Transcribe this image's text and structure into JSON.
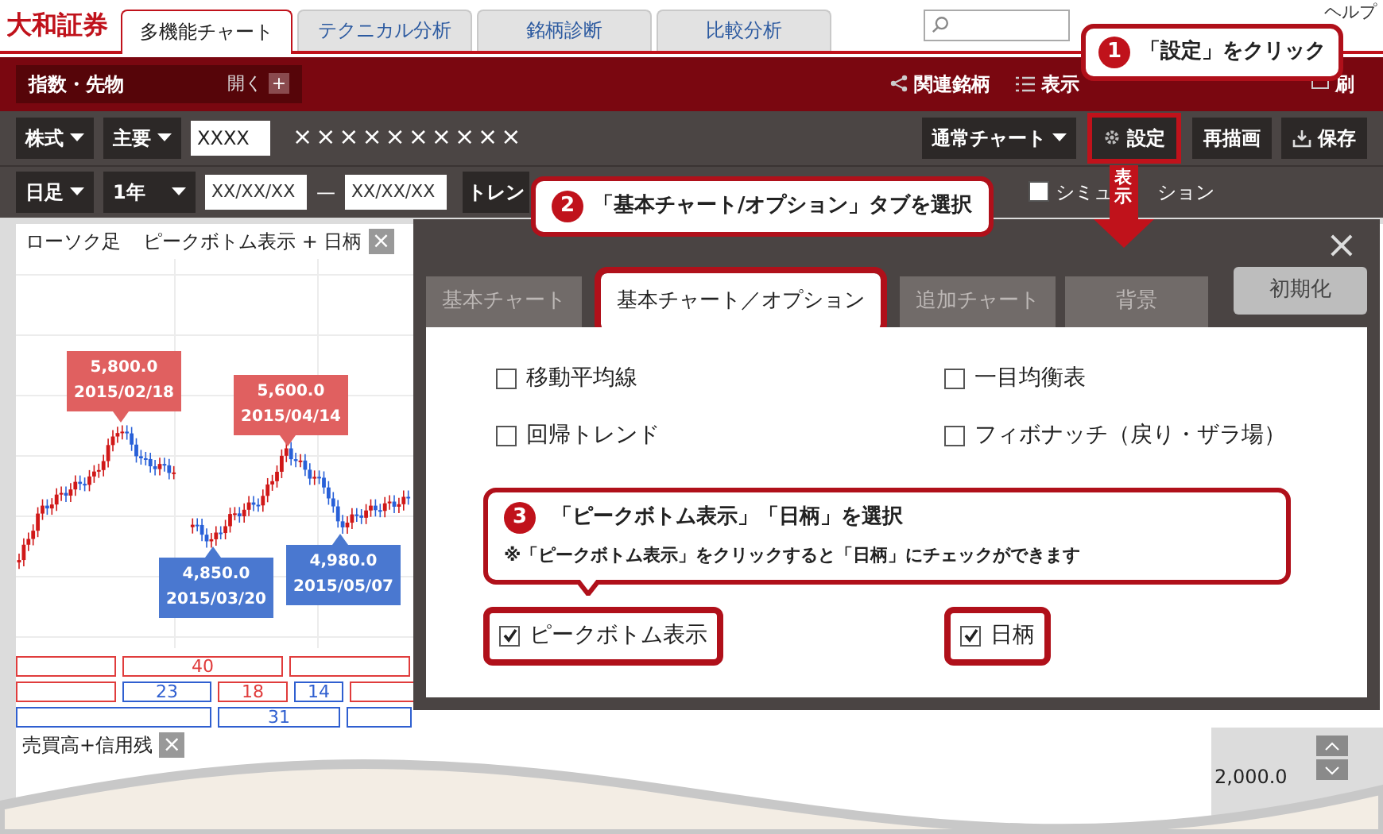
{
  "header": {
    "logo": "大和証券",
    "tabs": [
      {
        "label": "多機能チャート",
        "selected": true
      },
      {
        "label": "テクニカル分析",
        "selected": false
      },
      {
        "label": "銘柄診断",
        "selected": false
      },
      {
        "label": "比較分析",
        "selected": false
      }
    ],
    "help": "ヘルプ"
  },
  "nav_bar": {
    "panel_label": "指数・先物",
    "panel_toggle": "開く",
    "panel_icon": "+",
    "links": [
      {
        "label": "関連銘柄",
        "kind": "share"
      },
      {
        "label": "表示",
        "kind": "list"
      },
      {
        "label": "刷",
        "kind": "print"
      }
    ]
  },
  "toolbar": {
    "market": "株式",
    "index": "主要",
    "code": "XXXX",
    "name": "××××××××××",
    "chart_type": "通常チャート",
    "buttons": [
      {
        "label": "設定",
        "kind": "settings"
      },
      {
        "label": "再描画",
        "kind": "plain"
      },
      {
        "label": "保存",
        "kind": "save"
      }
    ]
  },
  "period_bar": {
    "unit": "日足",
    "range": "1年",
    "from": "XX/XX/XX",
    "separator": "—",
    "to": "XX/XX/XX",
    "trend": "トレン",
    "simulation": {
      "label_start": "シミュ",
      "label_end": "ション",
      "checked": false
    }
  },
  "chart": {
    "title": "ローソク足",
    "overlay": "ピークボトム表示 + 日柄",
    "close": "×",
    "markers": [
      {
        "value": "5,800.0",
        "date": "2015/02/18",
        "kind": "peak"
      },
      {
        "value": "5,600.0",
        "date": "2015/04/14",
        "kind": "peak"
      },
      {
        "value": "4,850.0",
        "date": "2015/03/20",
        "kind": "bottom"
      },
      {
        "value": "4,980.0",
        "date": "2015/05/07",
        "kind": "bottom"
      }
    ],
    "day_rows": [
      [
        {
          "color": "#e03c3c"
        },
        {
          "label": "40",
          "color": "#e03c3c"
        },
        {
          "color": "#e03c3c"
        }
      ],
      [
        {
          "color": "#e03c3c"
        },
        {
          "label": "23",
          "color": "#2f5fd0"
        },
        {
          "label": "18",
          "color": "#e03c3c"
        },
        {
          "label": "14",
          "color": "#2f5fd0"
        },
        {
          "color": "#e03c3c"
        }
      ],
      [
        {
          "color": "#2f5fd0"
        },
        {
          "label": "31",
          "color": "#2f5fd0"
        },
        {
          "color": "#2f5fd0"
        }
      ]
    ]
  },
  "volume_panel": {
    "title": "売買高+信用残",
    "close": "×",
    "axis_value": "2,000.0"
  },
  "dialog": {
    "close": "×",
    "tabs": [
      {
        "label": "基本チャート",
        "selected": false
      },
      {
        "label": "基本チャート／オプション",
        "selected": true
      },
      {
        "label": "追加チャート",
        "selected": false
      },
      {
        "label": "背景",
        "selected": false
      }
    ],
    "reset": "初期化",
    "options": [
      {
        "label": "移動平均線",
        "checked": false
      },
      {
        "label": "一目均衡表",
        "checked": false
      },
      {
        "label": "回帰トレンド",
        "checked": false
      },
      {
        "label": "フィボナッチ（戻り・ザラ場）",
        "checked": false
      }
    ],
    "peak_options": [
      {
        "label": "ピークボトム表示",
        "checked": true
      },
      {
        "label": "日柄",
        "checked": true
      }
    ]
  },
  "callouts": [
    {
      "number": "1",
      "text": "「設定」をクリック"
    },
    {
      "number": "2",
      "text": "「基本チャート/オプション」タブを選択"
    },
    {
      "number": "3",
      "text": "「ピークボトム表示」「日柄」を選択",
      "note": "※「ピークボトム表示」をクリックすると「日柄」にチェックができます"
    }
  ],
  "arrow_label": "表示"
}
